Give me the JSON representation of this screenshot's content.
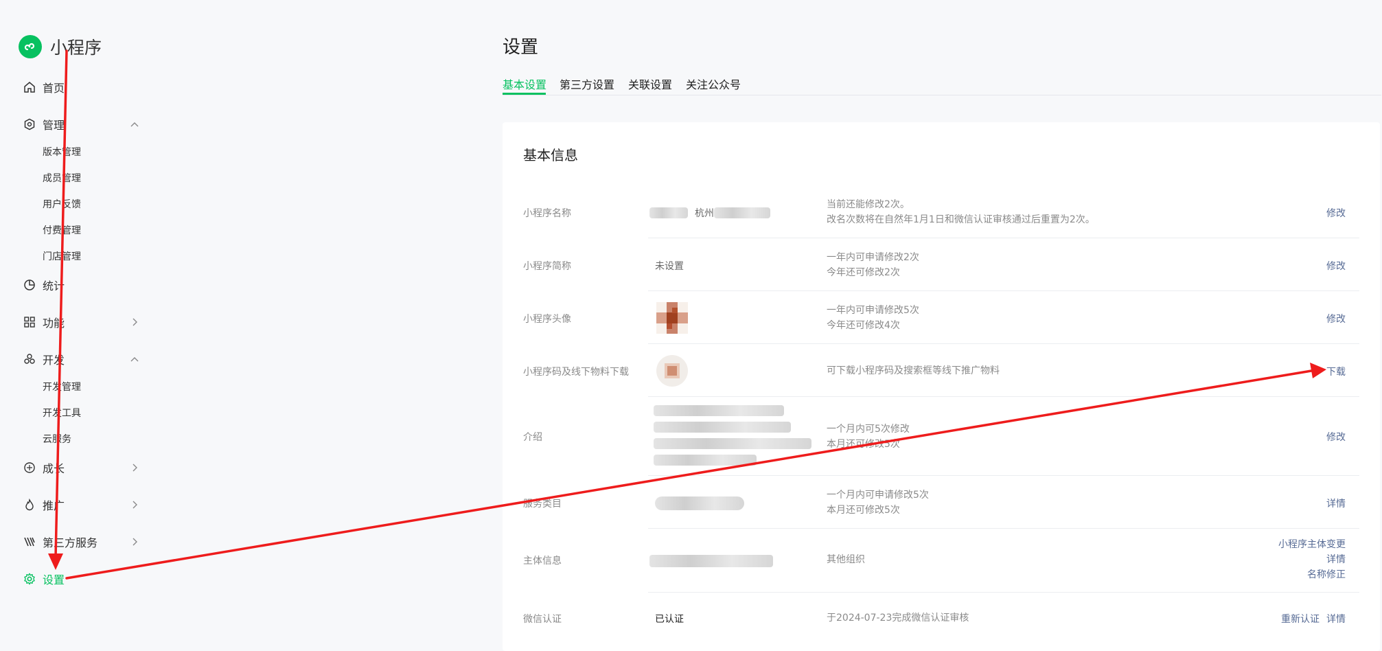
{
  "brand": {
    "title": "小程序",
    "icon": "mini-program-logo-icon"
  },
  "sidebar": {
    "items": [
      {
        "label": "首页",
        "icon": "home-icon"
      },
      {
        "label": "管理",
        "icon": "hexagon-settings-icon",
        "expanded": true,
        "children": [
          "版本管理",
          "成员管理",
          "用户反馈",
          "付费管理",
          "门店管理"
        ]
      },
      {
        "label": "统计",
        "icon": "pie-chart-icon"
      },
      {
        "label": "功能",
        "icon": "grid-apps-icon",
        "expanded": false
      },
      {
        "label": "开发",
        "icon": "cluster-icon",
        "expanded": true,
        "children": [
          "开发管理",
          "开发工具",
          "云服务"
        ]
      },
      {
        "label": "成长",
        "icon": "leaf-icon",
        "expanded": false
      },
      {
        "label": "推广",
        "icon": "flame-icon",
        "expanded": false
      },
      {
        "label": "第三方服务",
        "icon": "third-party-icon",
        "expanded": false
      },
      {
        "label": "设置",
        "icon": "gear-icon",
        "active": true
      }
    ]
  },
  "page": {
    "title": "设置"
  },
  "tabs": [
    "基本设置",
    "第三方设置",
    "关联设置",
    "关注公众号"
  ],
  "card": {
    "title": "基本信息",
    "rows": [
      {
        "label": "小程序名称",
        "value": "杭州",
        "desc": [
          "当前还能修改2次。",
          "改名次数将在自然年1月1日和微信认证审核通过后重置为2次。"
        ],
        "actions": [
          "修改"
        ]
      },
      {
        "label": "小程序简称",
        "value": "未设置",
        "desc": [
          "一年内可申请修改2次",
          "今年还可修改2次"
        ],
        "actions": [
          "修改"
        ]
      },
      {
        "label": "小程序头像",
        "value": "",
        "desc": [
          "一年内可申请修改5次",
          "今年还可修改4次"
        ],
        "actions": [
          "修改"
        ]
      },
      {
        "label": "小程序码及线下物料下载",
        "value": "",
        "desc": [
          "可下载小程序码及搜索框等线下推广物料"
        ],
        "actions": [
          "下载"
        ]
      },
      {
        "label": "介绍",
        "value": "",
        "desc": [
          "一个月内可5次修改",
          "本月还可修改5次"
        ],
        "actions": [
          "修改"
        ]
      },
      {
        "label": "服务类目",
        "value": "",
        "desc": [
          "一个月内可申请修改5次",
          "本月还可修改5次"
        ],
        "actions": [
          "详情"
        ]
      },
      {
        "label": "主体信息",
        "value": "",
        "desc": [
          "其他组织"
        ],
        "actions": [
          "小程序主体变更",
          "详情",
          "名称修正"
        ]
      },
      {
        "label": "微信认证",
        "value": "已认证",
        "desc": [
          "于2024-07-23完成微信认证审核"
        ],
        "actions": [
          "重新认证",
          "详情"
        ]
      }
    ]
  },
  "colors": {
    "accent": "#07c160",
    "link": "#576b95",
    "annotation": "#ee1c1c"
  }
}
